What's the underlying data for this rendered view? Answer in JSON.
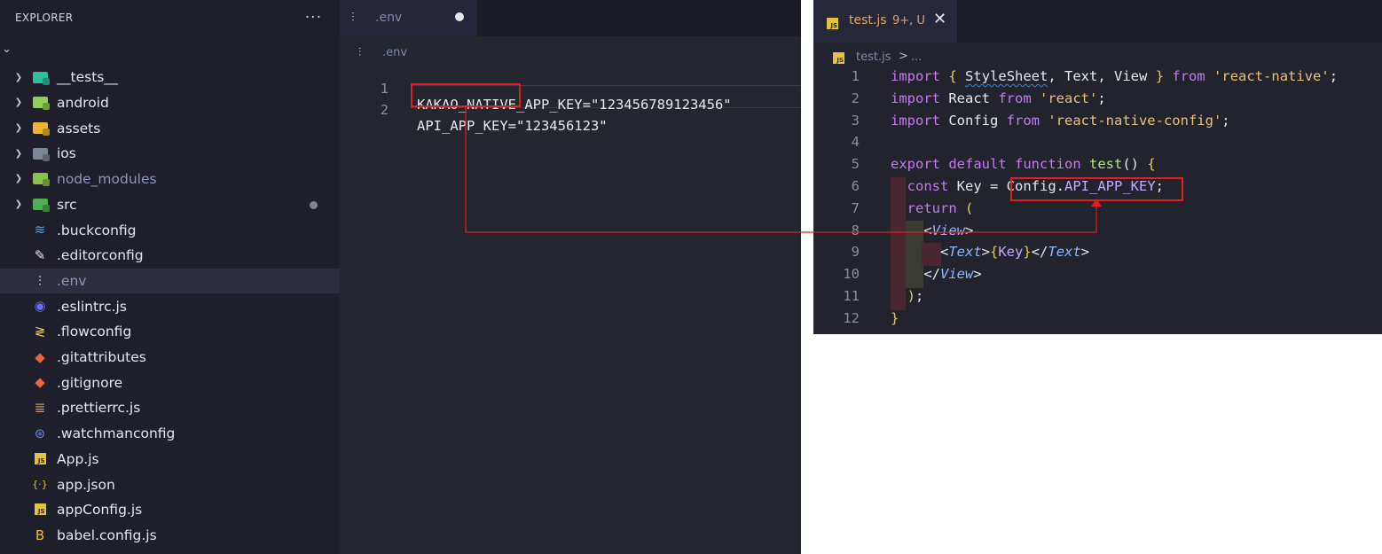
{
  "explorer": {
    "title": "EXPLORER",
    "more": "···",
    "section_chevron": "⌄",
    "items": [
      {
        "label": "__tests__",
        "kind": "folder",
        "color": "#2bbf9a",
        "muted": false
      },
      {
        "label": "android",
        "kind": "folder",
        "color": "#8fd14f",
        "muted": false
      },
      {
        "label": "assets",
        "kind": "folder",
        "color": "#f2b233",
        "muted": false
      },
      {
        "label": "ios",
        "kind": "folder",
        "color": "#7b8798",
        "muted": false
      },
      {
        "label": "node_modules",
        "kind": "folder",
        "color": "#8bc34a",
        "muted": true
      },
      {
        "label": "src",
        "kind": "folder",
        "color": "#4caf50",
        "muted": false,
        "dot": true
      },
      {
        "label": ".buckconfig",
        "kind": "file",
        "icon": "buck-icon",
        "glyph": "≋",
        "color": "#5aa0d8"
      },
      {
        "label": ".editorconfig",
        "kind": "file",
        "icon": "editorconfig-icon",
        "glyph": "✎",
        "color": "#e8e8e8"
      },
      {
        "label": ".env",
        "kind": "file",
        "icon": "env-icon",
        "glyph": "⫶",
        "color": "#c9cbe0",
        "selected": true,
        "muted": true
      },
      {
        "label": ".eslintrc.js",
        "kind": "file",
        "icon": "eslint-icon",
        "glyph": "◉",
        "color": "#6c6cf2"
      },
      {
        "label": ".flowconfig",
        "kind": "file",
        "icon": "flow-icon",
        "glyph": "≷",
        "color": "#e8c84a"
      },
      {
        "label": ".gitattributes",
        "kind": "file",
        "icon": "git-icon",
        "glyph": "◆",
        "color": "#e8643c"
      },
      {
        "label": ".gitignore",
        "kind": "file",
        "icon": "git-icon",
        "glyph": "◆",
        "color": "#e8643c"
      },
      {
        "label": ".prettierrc.js",
        "kind": "file",
        "icon": "prettier-icon",
        "glyph": "≣",
        "color": "#c0a070"
      },
      {
        "label": ".watchmanconfig",
        "kind": "file",
        "icon": "watchman-icon",
        "glyph": "⊛",
        "color": "#6a7ff0"
      },
      {
        "label": "App.js",
        "kind": "file",
        "icon": "js-icon",
        "glyph": "JS",
        "color": "#e6c23a"
      },
      {
        "label": "app.json",
        "kind": "file",
        "icon": "json-icon",
        "glyph": "{·}",
        "color": "#e6c23a"
      },
      {
        "label": "appConfig.js",
        "kind": "file",
        "icon": "js-icon",
        "glyph": "JS",
        "color": "#e6c23a"
      },
      {
        "label": "babel.config.js",
        "kind": "file",
        "icon": "babel-icon",
        "glyph": "B",
        "color": "#e6c23a"
      }
    ]
  },
  "env_editor": {
    "tab_label": ".env",
    "tab_icon": "⫶",
    "breadcrumb": ".env",
    "lines": [
      {
        "n": "1",
        "text": "KAKAO_NATIVE_APP_KEY=\"123456789123456\""
      },
      {
        "n": "2",
        "text": "API_APP_KEY=\"123456123\""
      }
    ]
  },
  "test_editor": {
    "tab_label": "test.js",
    "tab_status": "9+, U",
    "tab_close": "✕",
    "breadcrumb_file": "test.js",
    "breadcrumb_sep": ">",
    "breadcrumb_more": "...",
    "js_badge": "JS",
    "line_numbers": [
      "1",
      "2",
      "3",
      "4",
      "5",
      "6",
      "7",
      "8",
      "9",
      "10",
      "11",
      "12"
    ],
    "lines": [
      [
        "import",
        " ",
        "{",
        " ",
        "StyleSheet",
        ", Text, View ",
        "}",
        " ",
        "from",
        " ",
        "'react-native'",
        ";"
      ],
      [
        "import",
        " React ",
        "from",
        " ",
        "'react'",
        ";"
      ],
      [
        "import",
        " Config ",
        "from",
        " ",
        "'react-native-config'",
        ";"
      ],
      [],
      [
        "export",
        " ",
        "default",
        " ",
        "function",
        " ",
        "test",
        "() ",
        "{"
      ],
      [
        "  ",
        "const",
        " Key = ",
        "Config.",
        "API_APP_KEY",
        ";"
      ],
      [
        "  ",
        "return",
        " ",
        "("
      ],
      [
        "    <",
        "View",
        ">"
      ],
      [
        "      <",
        "Text",
        ">",
        "{",
        "Key",
        "}",
        "</",
        "Text",
        ">"
      ],
      [
        "    </",
        "View",
        ">"
      ],
      [
        "  ",
        ")",
        ";"
      ],
      [
        "}"
      ]
    ]
  },
  "annotation_color": "#e02020"
}
